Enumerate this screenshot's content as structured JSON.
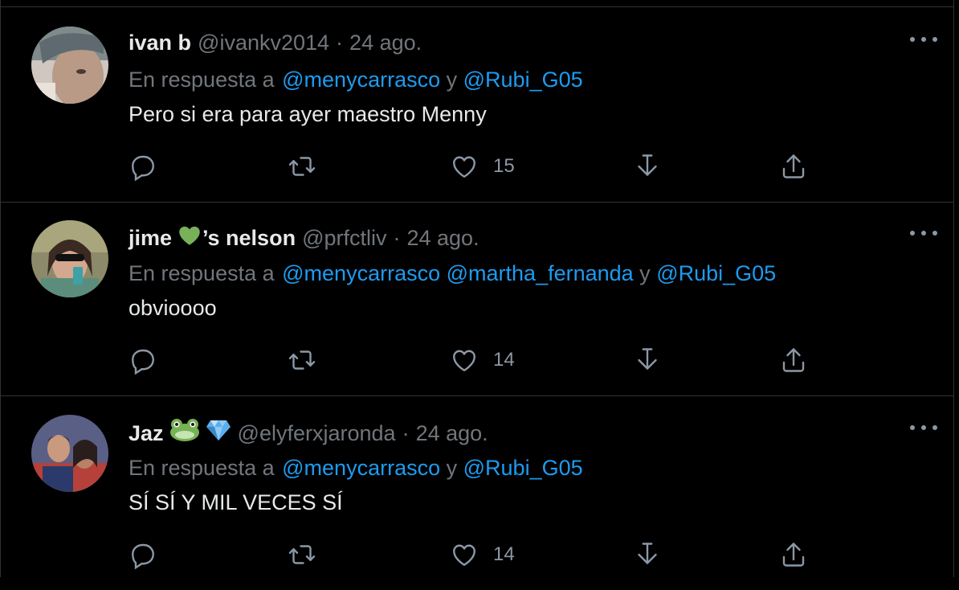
{
  "tweets": [
    {
      "name": "ivan b",
      "name_emojis": [],
      "handle": "@ivankv2014",
      "dot": "·",
      "date": "24 ago.",
      "reply_prefix": "En respuesta a",
      "mentions": [
        "@menycarrasco",
        "@Rubi_G05"
      ],
      "separators": [
        " y "
      ],
      "text": "Pero si era para ayer maestro Menny",
      "likes": "15"
    },
    {
      "name": "jime",
      "name_emojis": [
        "green-heart"
      ],
      "name_suffix": "’s nelson",
      "handle": "@prfctliv",
      "dot": "·",
      "date": "24 ago.",
      "reply_prefix": "En respuesta a",
      "mentions": [
        "@menycarrasco",
        "@martha_fernanda",
        "@Rubi_G05"
      ],
      "separators": [
        " ",
        " y "
      ],
      "text": "obvioooo",
      "likes": "14"
    },
    {
      "name": "Jaz",
      "name_emojis": [
        "frog",
        "gem"
      ],
      "handle": "@elyferxjaronda",
      "dot": "·",
      "date": "24 ago.",
      "reply_prefix": "En respuesta a",
      "mentions": [
        "@menycarrasco",
        "@Rubi_G05"
      ],
      "separators": [
        " y "
      ],
      "text": "SÍ SÍ Y MIL VECES SÍ",
      "likes": "14"
    }
  ],
  "colors": {
    "background": "#000000",
    "text": "#e7e9ea",
    "secondary": "#71767b",
    "link": "#1d9bf0",
    "icon": "#8b98a5"
  }
}
